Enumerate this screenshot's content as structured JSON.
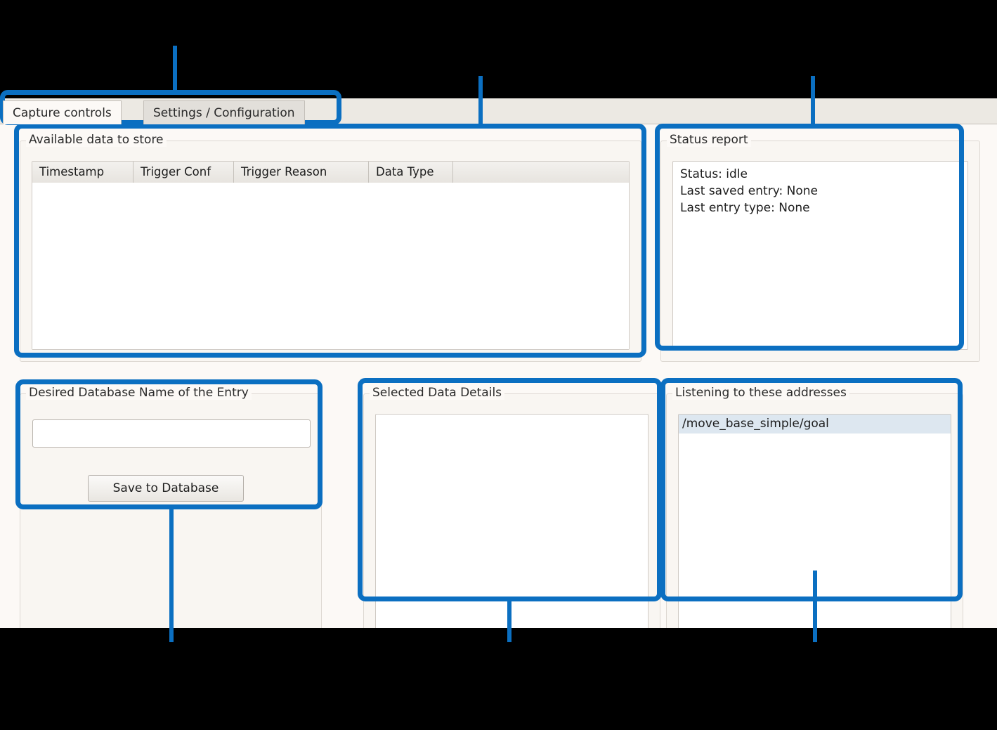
{
  "app": {
    "background_color": "#fcf9f6",
    "accent_color": "#0b6fc1"
  },
  "tabs": [
    {
      "label": "Capture controls",
      "active": true
    },
    {
      "label": "Settings / Configuration",
      "active": false
    }
  ],
  "panels": {
    "available_data": {
      "title": "Available data to store",
      "table": {
        "columns": [
          "Timestamp",
          "Trigger Conf",
          "Trigger Reason",
          "Data Type"
        ],
        "rows": []
      }
    },
    "status_report": {
      "title": "Status report",
      "lines": [
        "Status: idle",
        "Last saved entry: None",
        "Last entry type: None"
      ]
    },
    "database_name": {
      "title": "Desired Database Name of the Entry",
      "input_value": "",
      "input_placeholder": "",
      "save_button_label": "Save to Database"
    },
    "selected_data_details": {
      "title": "Selected Data Details",
      "content": ""
    },
    "listening_addresses": {
      "title": "Listening to these addresses",
      "items": [
        {
          "label": "/move_base_simple/goal",
          "selected": true
        }
      ]
    }
  }
}
